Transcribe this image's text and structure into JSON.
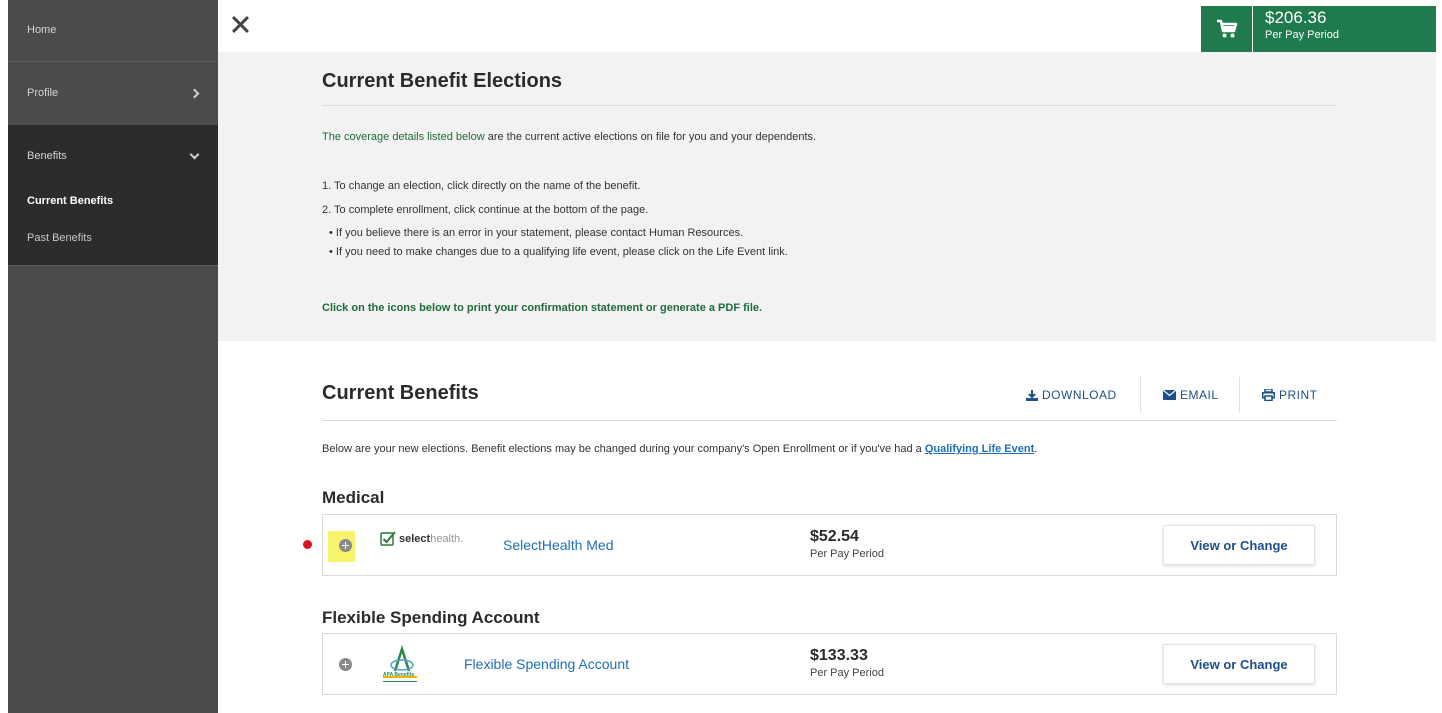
{
  "sidebar": {
    "home": "Home",
    "profile": "Profile",
    "benefits": "Benefits",
    "sub_items": [
      "Current Benefits",
      "Past Benefits"
    ]
  },
  "cart": {
    "amount": "$206.36",
    "period": "Per Pay Period",
    "icon": "shopping-cart-icon"
  },
  "elections": {
    "title": "Current Benefit Elections",
    "intro_bold": "The coverage details listed below",
    "intro_rest": " are the current active elections on file for you and your dependents.",
    "steps": [
      "1. To change an election, click directly on the name of the benefit.",
      "2. To complete enrollment, click continue at the bottom of the page."
    ],
    "bullets": [
      "If you believe there is an error in your statement, please contact Human Resources.",
      "If you need to make changes due to a qualifying life event, please click on the Life Event link."
    ],
    "print_note": "Click on the icons below to print your confirmation statement or generate a PDF file."
  },
  "current": {
    "title": "Current Benefits",
    "actions": {
      "download": "DOWNLOAD",
      "email": "EMAIL",
      "print": "PRINT"
    },
    "desc_prefix": "Below are your new elections. Benefit elections may be changed during your company's Open Enrollment or if you've had a ",
    "desc_link": "Qualifying Life Event",
    "desc_suffix": ".",
    "sections": [
      {
        "heading": "Medical",
        "logo_text_bold": "select",
        "logo_text_light": "health.",
        "name": "SelectHealth Med",
        "price": "$52.54",
        "period": "Per Pay Period",
        "button": "View or Change"
      },
      {
        "heading": "Flexible Spending Account",
        "logo_text": "APA Benefits",
        "name": "Flexible Spending Account",
        "price": "$133.33",
        "period": "Per Pay Period",
        "button": "View or Change"
      }
    ]
  },
  "colors": {
    "brand_green": "#1f7a4d",
    "link_blue": "#1e6fb8",
    "sidebar": "#4a4a4a"
  }
}
